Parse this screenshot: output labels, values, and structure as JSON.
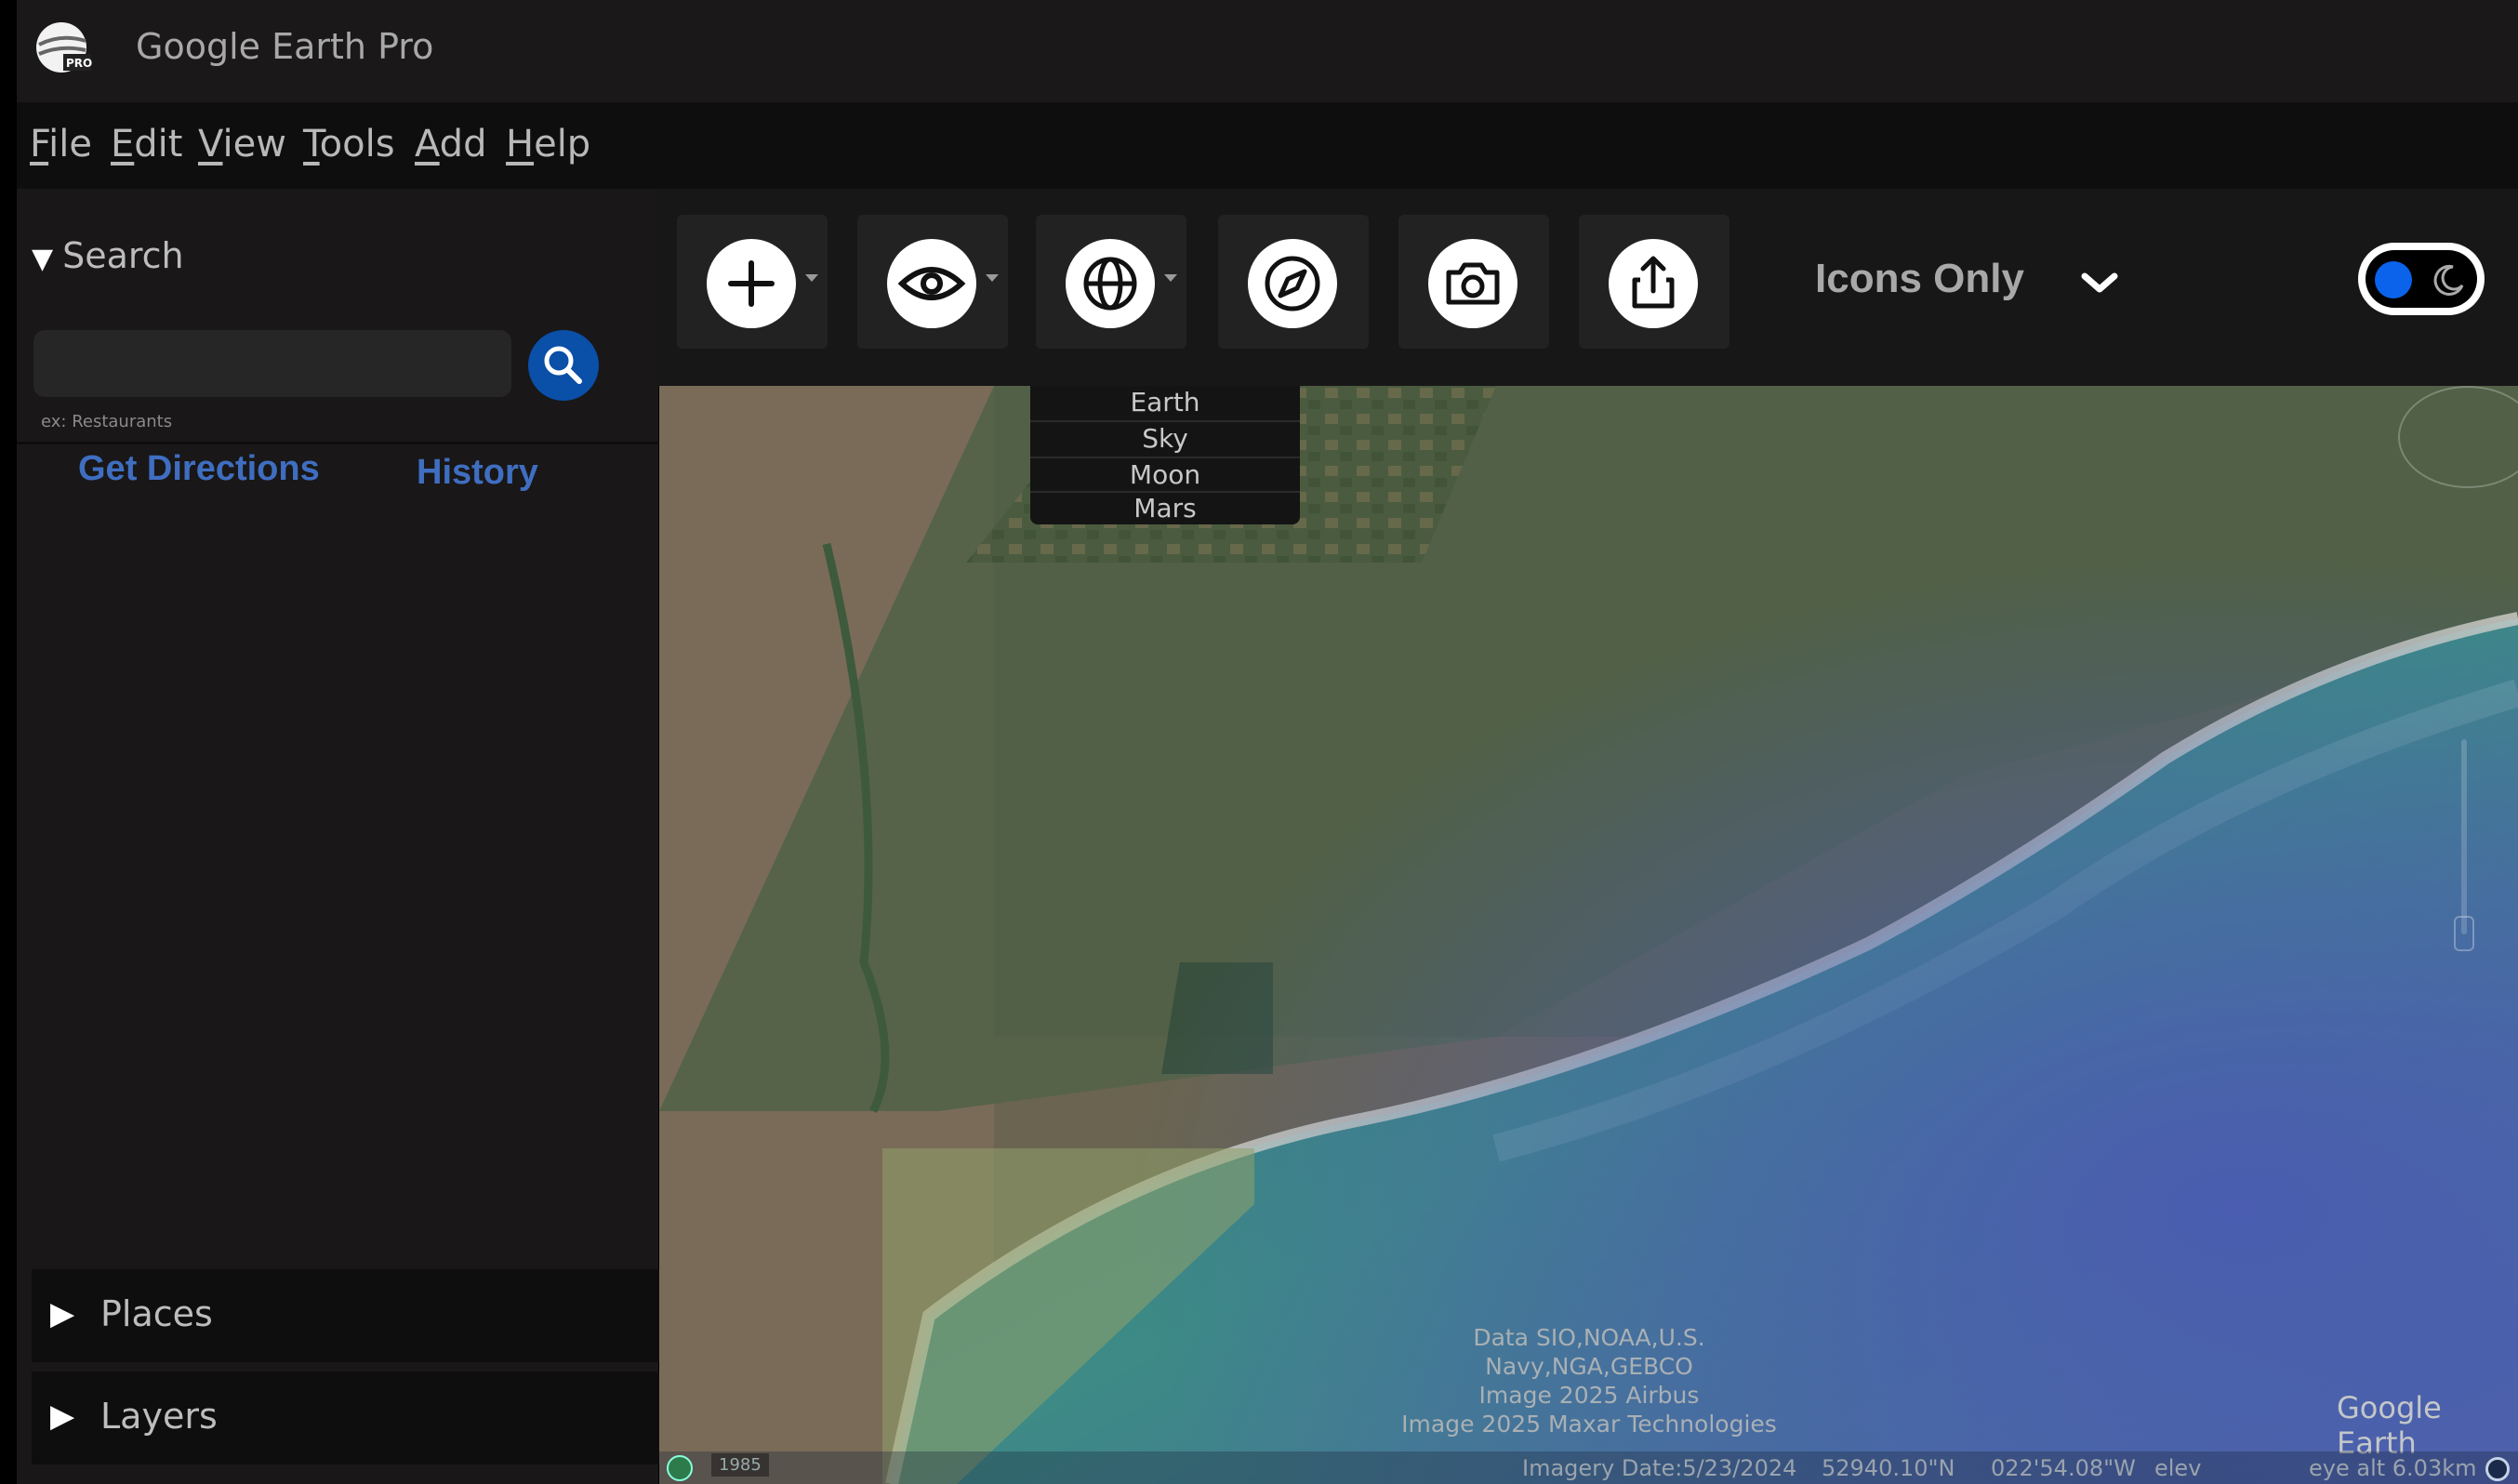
{
  "app": {
    "title": "Google Earth Pro"
  },
  "menu": [
    {
      "acc": "F",
      "rest": "ile"
    },
    {
      "acc": "E",
      "rest": "dit"
    },
    {
      "acc": "V",
      "rest": "iew"
    },
    {
      "acc": "T",
      "rest": "ools"
    },
    {
      "acc": "A",
      "rest": "dd"
    },
    {
      "acc": "H",
      "rest": "elp"
    }
  ],
  "sidebar": {
    "search_label": "Search",
    "search_value": "",
    "search_hint": "ex: Restaurants",
    "get_directions": "Get Directions",
    "history": "History",
    "places": "Places",
    "layers": "Layers"
  },
  "toolbar": {
    "display_mode": "Icons Only",
    "icons": [
      "add-icon",
      "eye-icon",
      "globe-icon",
      "compass-icon",
      "camera-icon",
      "share-icon"
    ]
  },
  "planet_menu": [
    "Earth",
    "Sky",
    "Moon",
    "Mars"
  ],
  "map": {
    "attribution": [
      "Data SIO,NOAA,U.S. Navy,NGA,GEBCO",
      "Image  2025 Airbus",
      "Image 2025 Maxar Technologies"
    ],
    "brand": "Google Earth",
    "year": "1985",
    "imagery_date": "Imagery Date:5/23/2024",
    "latitude": "52940.10\"N",
    "longitude": "022'54.08\"W",
    "elev": "elev",
    "eye_alt": "eye alt  6.03km"
  },
  "colors": {
    "accent": "#0a4fa8",
    "link": "#3f6ec1",
    "toggle_knob": "#0a63ea"
  }
}
